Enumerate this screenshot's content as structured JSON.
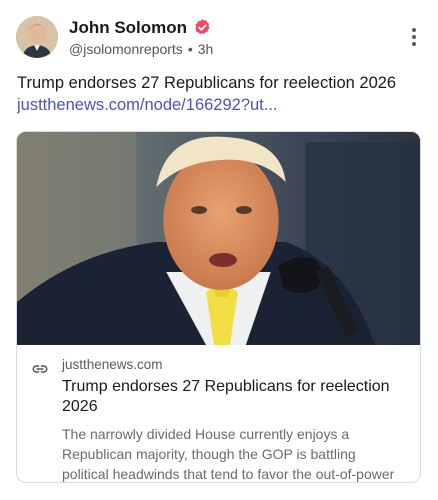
{
  "author": {
    "display_name": "John Solomon",
    "handle": "@jsolomonreports",
    "separator": "•",
    "time": "3h",
    "verified": true,
    "verified_color": "#ee4b63"
  },
  "post": {
    "text": "Trump endorses 27 Republicans for reelection 2026",
    "link": "justthenews.com/node/166292?ut..."
  },
  "link_card": {
    "domain": "justthenews.com",
    "title": "Trump endorses 27 Republicans for reelection 2026",
    "description": "The narrowly divided House currently enjoys a Republican majority, though the GOP is battling political headwinds that tend to favor the out-of-power party.",
    "image_subject": "photo of a man in dark suit and yellow tie speaking at a microphone"
  },
  "icons": {
    "verified": "verified-badge-icon",
    "more": "more-vertical-icon",
    "link": "link-icon"
  },
  "colors": {
    "link": "#4a51c4",
    "border": "#dcdcdc"
  }
}
